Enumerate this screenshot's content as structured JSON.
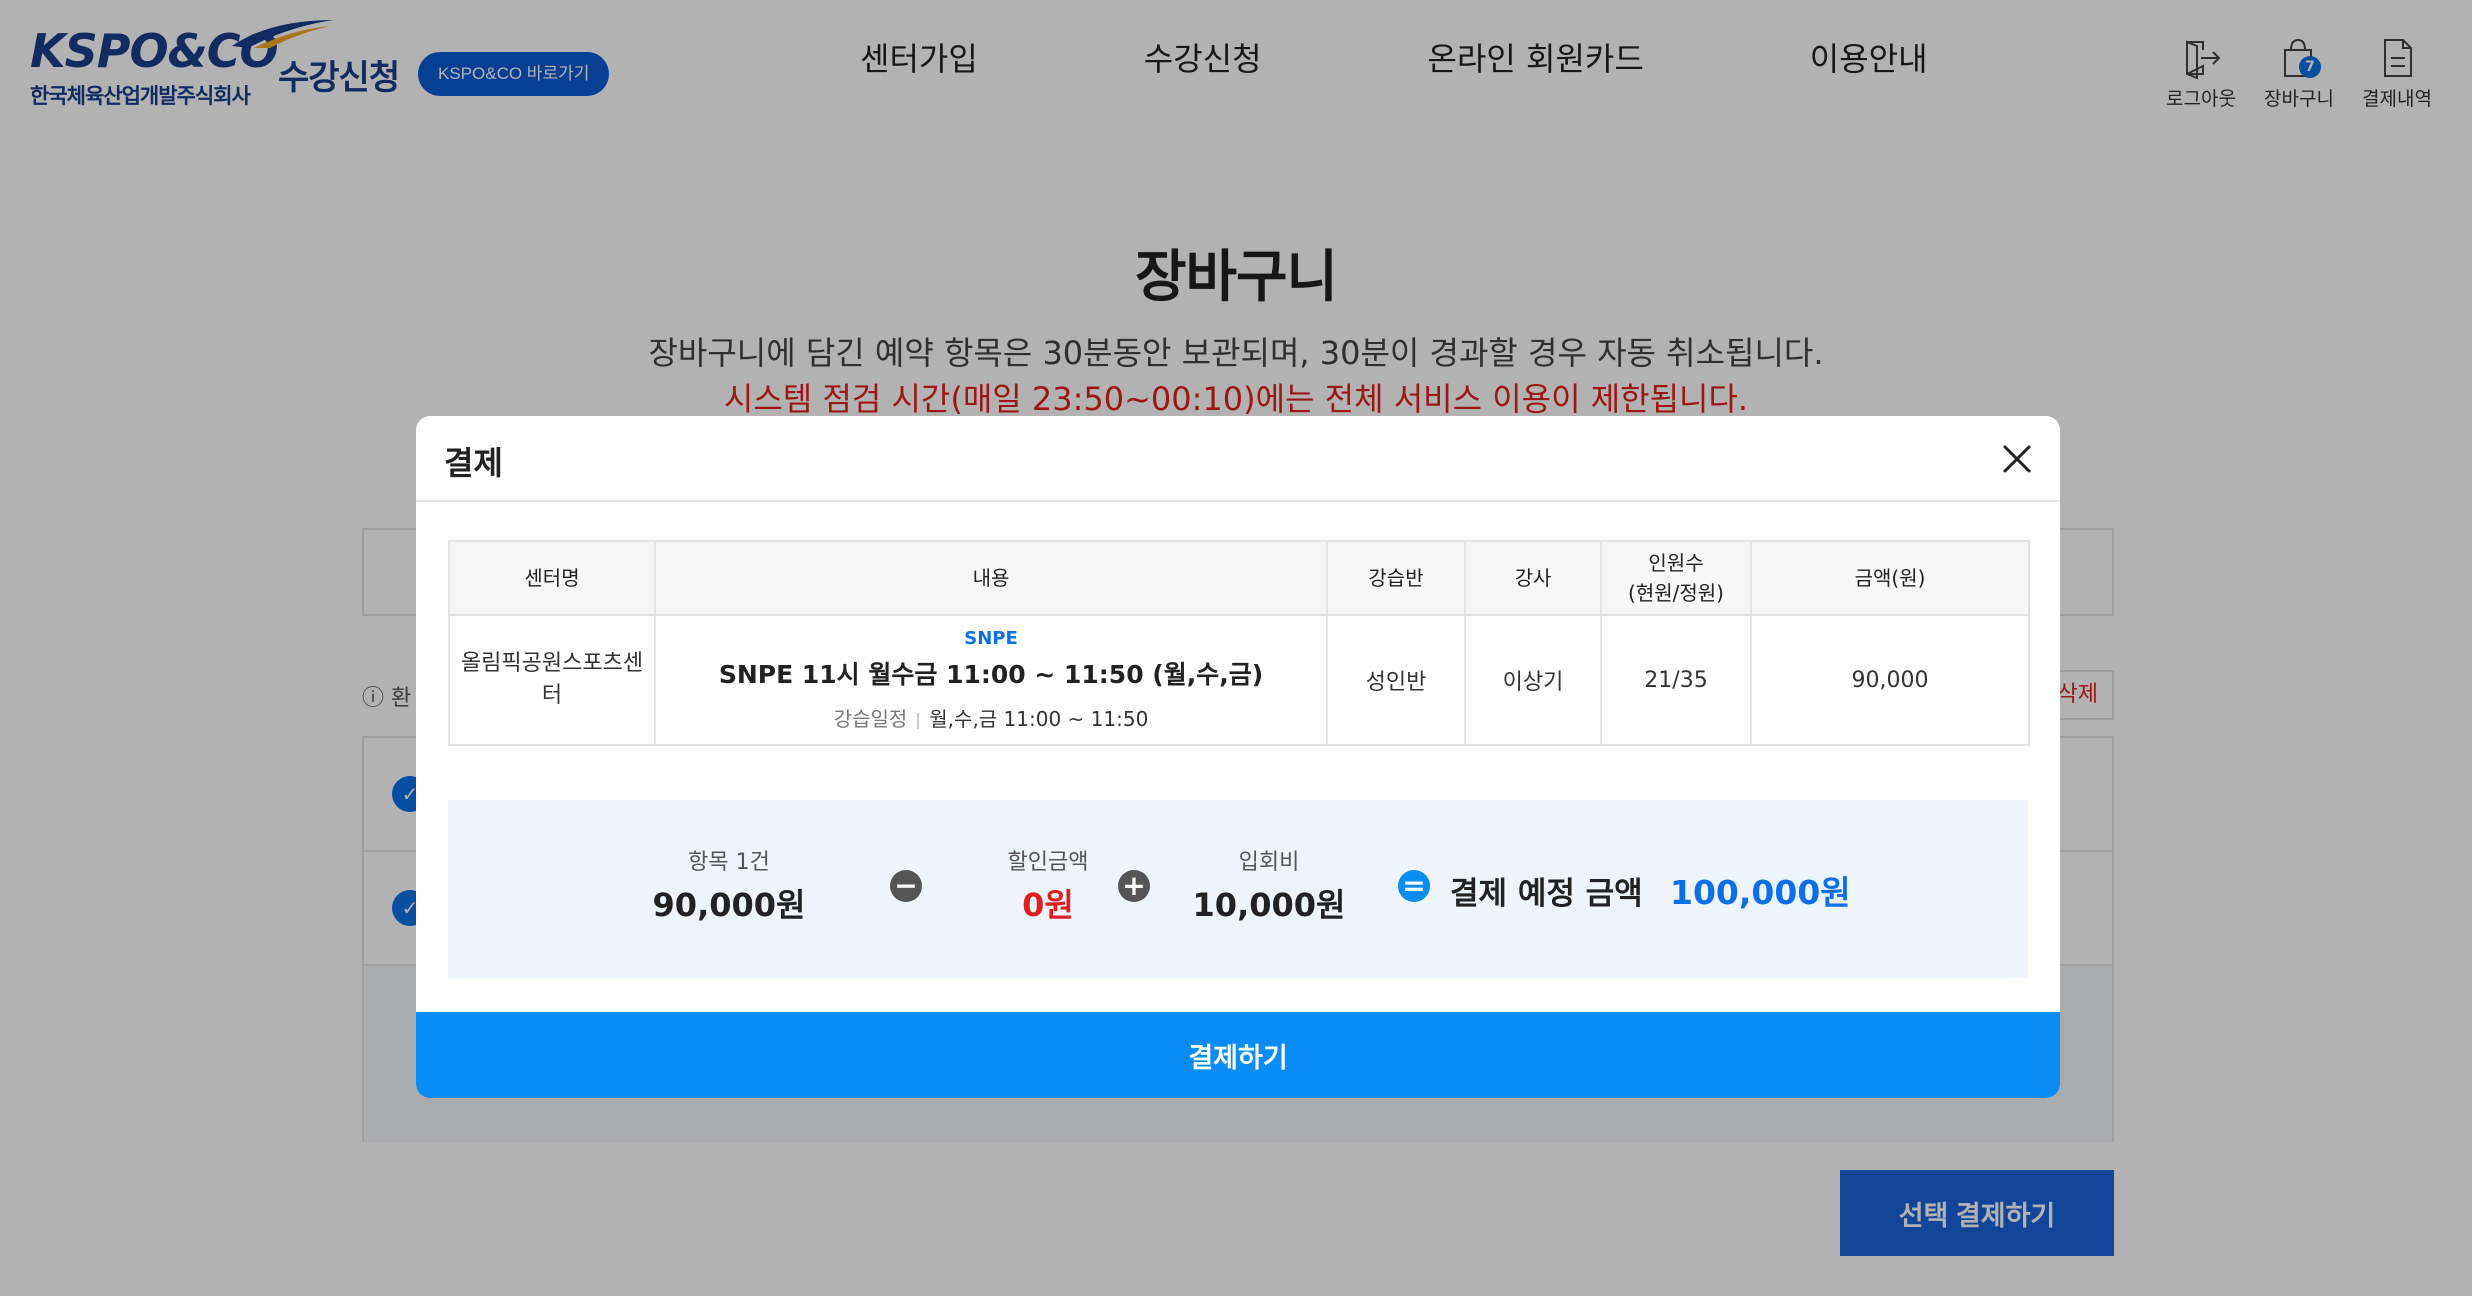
{
  "header": {
    "logo_mark": "KSPO&CO",
    "logo_sub": "한국체육산업개발주식회사",
    "site_title": "수강신청",
    "shortcut_label": "KSPO&CO 바로가기",
    "nav": [
      "센터가입",
      "수강신청",
      "온라인 회원카드",
      "이용안내"
    ],
    "util": {
      "logout": "로그아웃",
      "cart": "장바구니",
      "cart_count": "7",
      "history": "결제내역"
    }
  },
  "page": {
    "title": "장바구니",
    "desc": "장바구니에 담긴 예약 항목은 30분동안 보관되며, 30분이 경과할 경우 자동 취소됩니다.",
    "warning": "시스템 점검 시간(매일 23:50~00:10)에는 전체 서비스 이용이 제한됩니다.",
    "info_prefix": "환",
    "delete_label": "삭제",
    "select_pay_label": "선택 결제하기"
  },
  "modal": {
    "title": "결제",
    "columns": {
      "center": "센터명",
      "content": "내용",
      "class": "강습반",
      "instructor": "강사",
      "count_line1": "인원수",
      "count_line2": "(현원/정원)",
      "price": "금액(원)"
    },
    "rows": [
      {
        "center": "올림픽공원스포츠센터",
        "tag": "SNPE",
        "course": "SNPE 11시 월수금 11:00 ~ 11:50 (월,수,금)",
        "schedule_label": "강습일정",
        "schedule": "월,수,금 11:00 ~ 11:50",
        "class": "성인반",
        "instructor": "이상기",
        "count": "21/35",
        "price": "90,000"
      }
    ],
    "summary": {
      "items_label": "항목 1건",
      "items_value": "90,000원",
      "discount_label": "할인금액",
      "discount_value": "0원",
      "fee_label": "입회비",
      "fee_value": "10,000원",
      "total_label": "결제 예정 금액",
      "total_value": "100,000원"
    },
    "pay_label": "결제하기"
  },
  "colors": {
    "brand": "#1a3f8c",
    "accent": "#0a8cf7",
    "warning": "#e02020"
  }
}
